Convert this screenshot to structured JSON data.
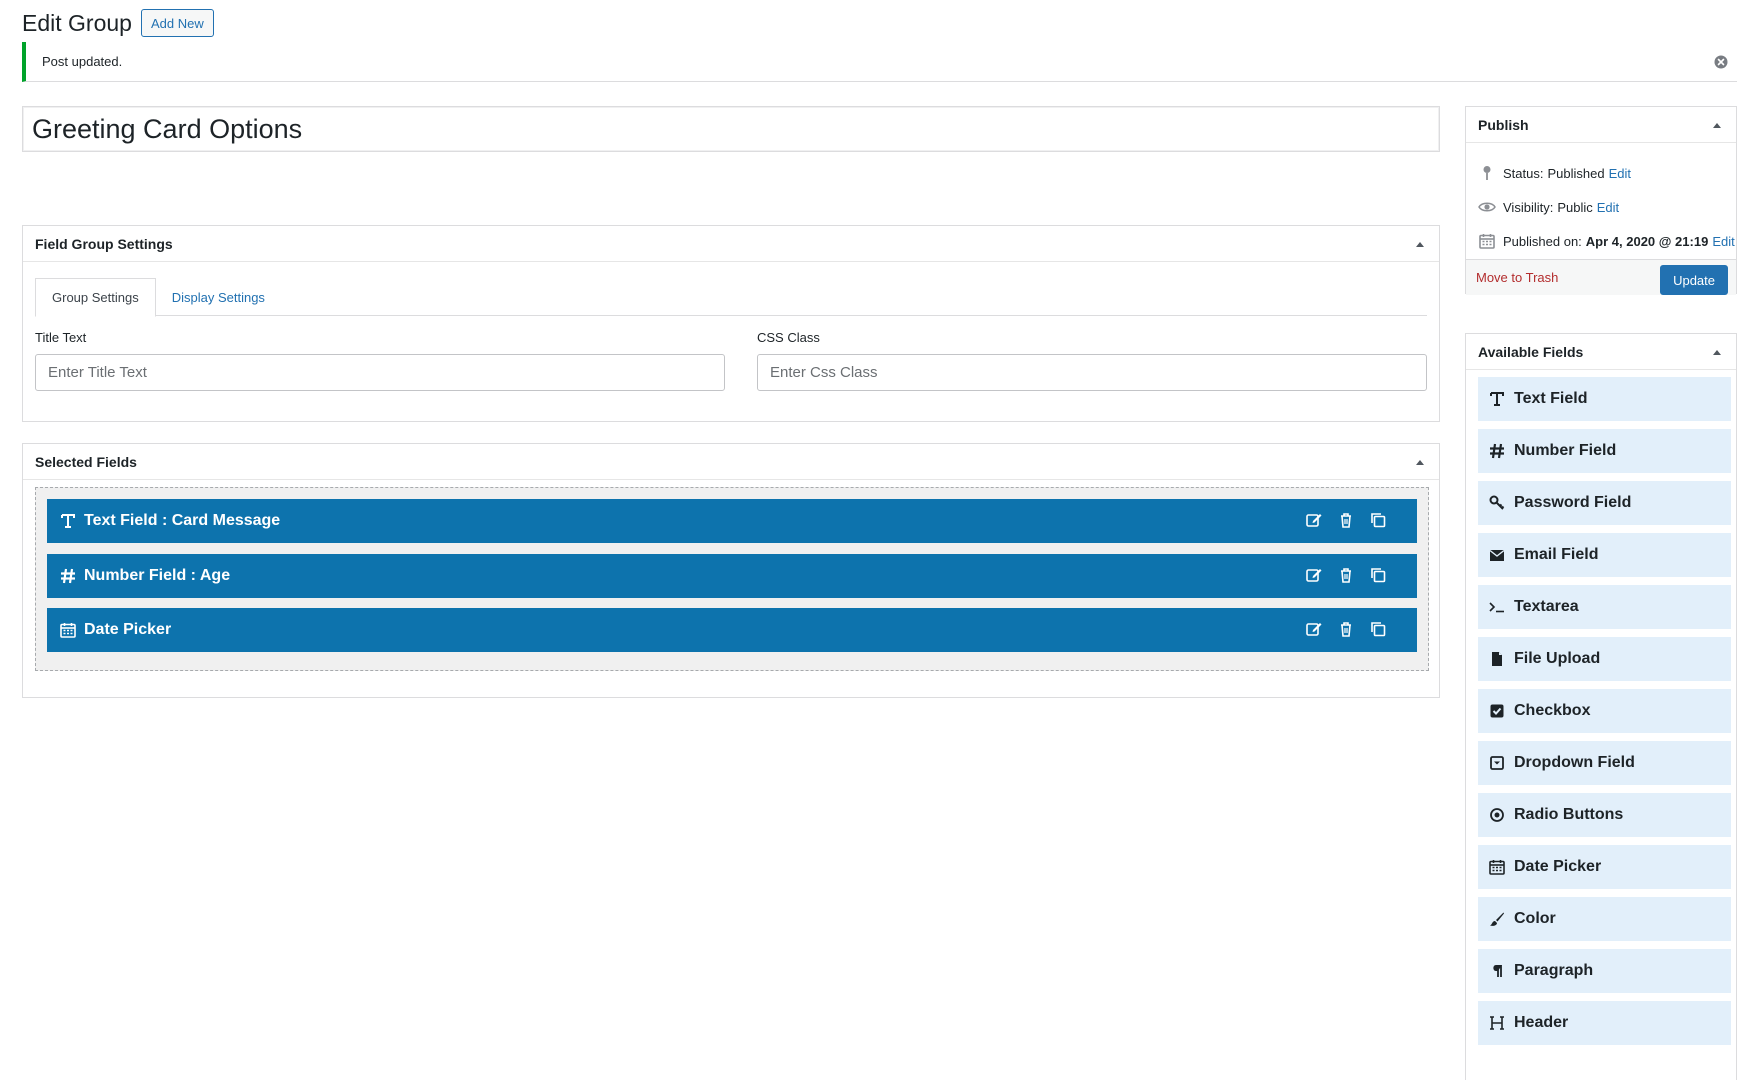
{
  "header": {
    "title": "Edit Group",
    "add_new_label": "Add New"
  },
  "notice": {
    "text": "Post updated."
  },
  "post_title": {
    "value": "Greeting Card Options"
  },
  "field_group_settings": {
    "title": "Field Group Settings",
    "tabs": [
      {
        "label": "Group Settings",
        "active": true
      },
      {
        "label": "Display Settings",
        "active": false
      }
    ],
    "title_text": {
      "label": "Title Text",
      "placeholder": "Enter Title Text",
      "value": ""
    },
    "css_class": {
      "label": "CSS Class",
      "placeholder": "Enter Css Class",
      "value": ""
    }
  },
  "selected_fields": {
    "title": "Selected Fields",
    "items": [
      {
        "icon": "text-cursor-icon",
        "label": "Text Field : Card Message"
      },
      {
        "icon": "hash-icon",
        "label": "Number Field : Age"
      },
      {
        "icon": "calendar-icon",
        "label": "Date Picker"
      }
    ]
  },
  "publish": {
    "title": "Publish",
    "status_label": "Status:",
    "status_value": "Published",
    "visibility_label": "Visibility:",
    "visibility_value": "Public",
    "published_on_label": "Published on:",
    "published_on_value": "Apr 4, 2020 @ 21:19",
    "edit_label": "Edit",
    "trash_label": "Move to Trash",
    "update_label": "Update"
  },
  "available_fields": {
    "title": "Available Fields",
    "items": [
      {
        "icon": "text-cursor-icon",
        "label": "Text Field"
      },
      {
        "icon": "hash-icon",
        "label": "Number Field"
      },
      {
        "icon": "key-icon",
        "label": "Password Field"
      },
      {
        "icon": "envelope-icon",
        "label": "Email Field"
      },
      {
        "icon": "terminal-icon",
        "label": "Textarea"
      },
      {
        "icon": "file-icon",
        "label": "File Upload"
      },
      {
        "icon": "checkbox-icon",
        "label": "Checkbox"
      },
      {
        "icon": "dropdown-icon",
        "label": "Dropdown Field"
      },
      {
        "icon": "radio-icon",
        "label": "Radio Buttons"
      },
      {
        "icon": "calendar-icon",
        "label": "Date Picker"
      },
      {
        "icon": "brush-icon",
        "label": "Color"
      },
      {
        "icon": "paragraph-icon",
        "label": "Paragraph"
      },
      {
        "icon": "header-icon",
        "label": "Header"
      }
    ]
  },
  "colors": {
    "primary_blue": "#0d73ad",
    "link_blue": "#2271b1",
    "available_item_bg": "#e2effa",
    "notice_green": "#00a32a",
    "trash_red": "#b32d2e"
  }
}
